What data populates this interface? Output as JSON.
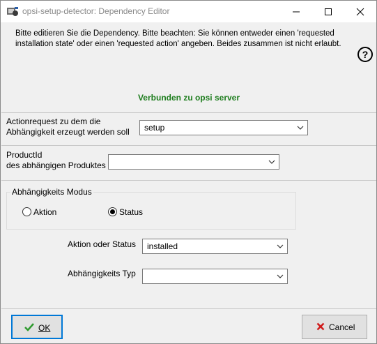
{
  "window": {
    "title": "opsi-setup-detector: Dependency Editor",
    "icons": [
      "app-icon",
      "minimize-icon",
      "maximize-icon",
      "close-icon"
    ]
  },
  "info": {
    "text": "Bitte editieren Sie die Dependency. Bitte beachten: Sie können entweder einen 'requested installation state' oder einen 'requested action' angeben. Beides zusammen ist nicht erlaubt.",
    "help_label": "?",
    "status": "Verbunden zu opsi server",
    "status_color": "#1e7d1e"
  },
  "actionrequest": {
    "label_line1": "Actionrequest zu dem die",
    "label_line2": "Abhängigkeit erzeugt werden soll",
    "value": "setup"
  },
  "productid": {
    "label_line1": "ProductId",
    "label_line2": "des abhängigen Produktes",
    "value": ""
  },
  "mode": {
    "title": "Abhängigkeits Modus",
    "options": [
      {
        "label": "Aktion",
        "selected": false
      },
      {
        "label": "Status",
        "selected": true
      }
    ]
  },
  "action_or_status": {
    "label": "Aktion oder Status",
    "value": "installed"
  },
  "dependency_type": {
    "label": "Abhängigkeits Typ",
    "value": ""
  },
  "buttons": {
    "ok_label": "OK",
    "cancel_label": "Cancel",
    "ok_icon_color": "#2e9a2e",
    "cancel_icon_color": "#d01c1c",
    "focus_color": "#0078d7"
  }
}
